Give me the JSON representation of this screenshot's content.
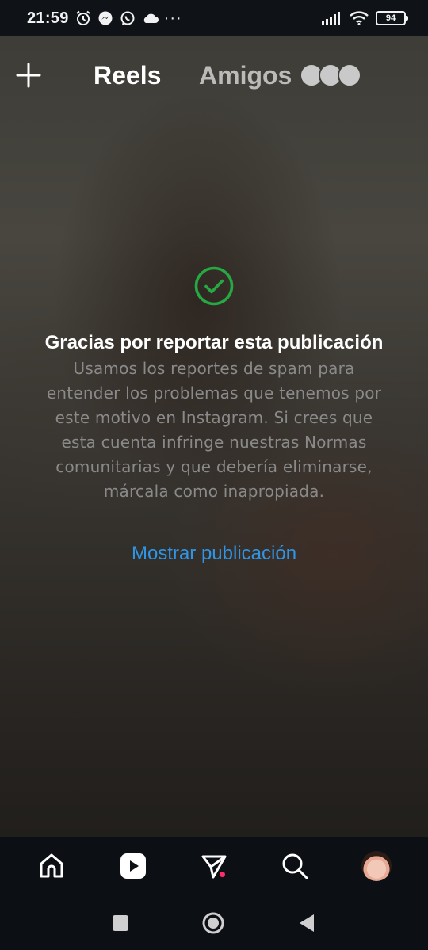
{
  "status_bar": {
    "time": "21:59",
    "left_icons": [
      "alarm-icon",
      "messenger-icon",
      "whatsapp-icon",
      "cloud-icon"
    ],
    "more_dots": "···",
    "right_icons": [
      "signal-icon",
      "wifi-icon"
    ],
    "battery_level": "94"
  },
  "header": {
    "create_icon": "plus-icon",
    "tabs": [
      {
        "label": "Reels",
        "active": true
      },
      {
        "label": "Amigos",
        "active": false
      }
    ]
  },
  "report": {
    "icon": "check-circle-icon",
    "icon_color": "#26a843",
    "title": "Gracias por reportar esta publicación",
    "body": "Usamos los reportes de spam para entender los problemas que tenemos por este motivo en Instagram. Si crees que esta cuenta infringe nuestras Normas comunitarias y que debería eliminarse, márcala como inapropiada.",
    "link": "Mostrar publicación",
    "link_color": "#2f95e6"
  },
  "bottom_nav": {
    "items": [
      "home-icon",
      "reels-icon",
      "direct-messages-icon",
      "search-icon",
      "profile-avatar"
    ],
    "active": "reels-icon"
  },
  "system_nav": {
    "buttons": [
      "recents-button",
      "home-button",
      "back-button"
    ]
  }
}
